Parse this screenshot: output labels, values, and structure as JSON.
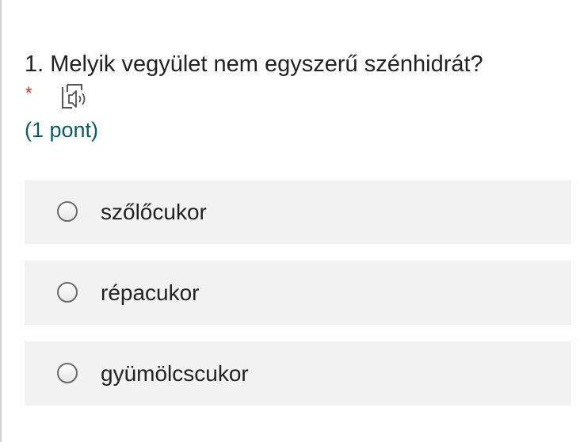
{
  "question": {
    "title": "1. Melyik vegyület nem egyszerű szénhidrát?",
    "required_mark": "*",
    "audio_icon": "read-aloud-speaker-icon",
    "points": "(1 pont)"
  },
  "options": [
    {
      "label": "szőlőcukor",
      "selected": false
    },
    {
      "label": "répacukor",
      "selected": false
    },
    {
      "label": "gyümölcscukor",
      "selected": false
    }
  ],
  "colors": {
    "required": "#d93025",
    "points": "#0b5c63",
    "option_background": "#f2f2f2",
    "text": "#222222"
  }
}
